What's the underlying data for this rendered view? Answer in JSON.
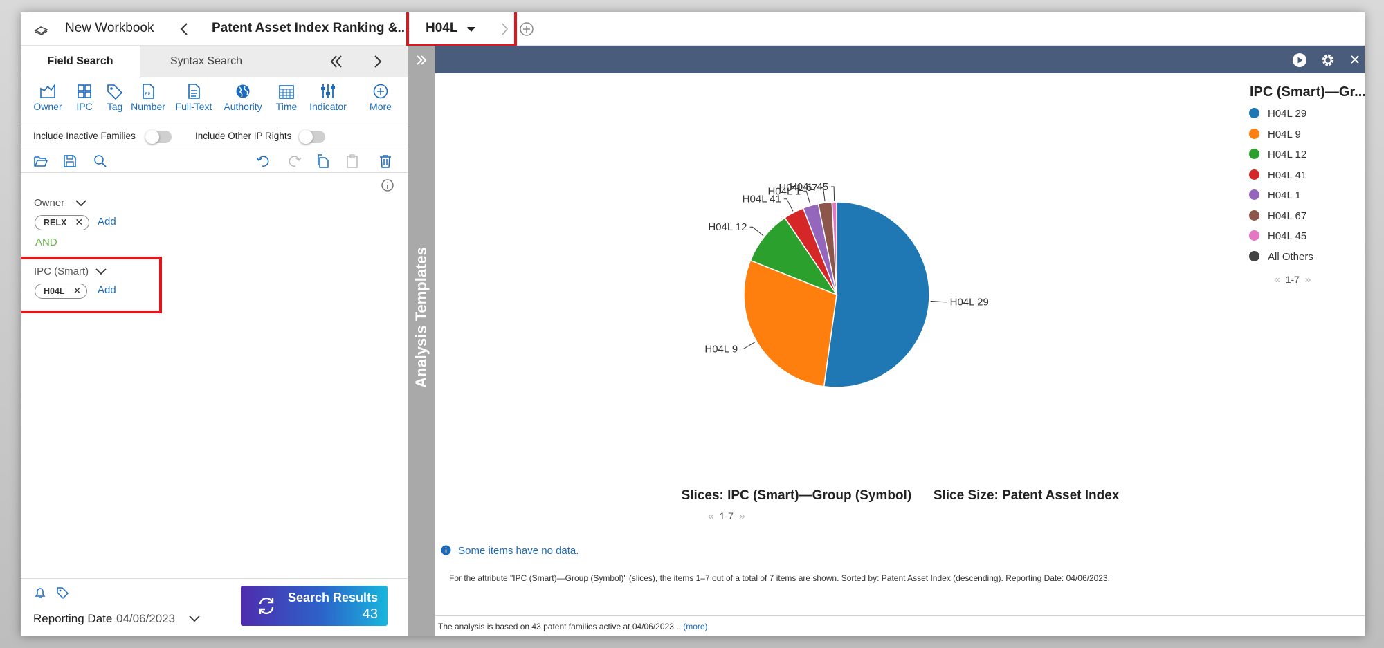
{
  "topbar": {
    "workbook_label": "New Workbook",
    "breadcrumb_title": "Patent Asset Index Ranking &...",
    "active_tab": "H04L"
  },
  "search_panel": {
    "tabs": [
      "Field Search",
      "Syntax Search"
    ],
    "tools": [
      {
        "label": "Owner",
        "icon": "owner-icon"
      },
      {
        "label": "IPC",
        "icon": "grid-icon"
      },
      {
        "label": "Tag",
        "icon": "tag-icon"
      },
      {
        "label": "Number",
        "icon": "document-icon"
      },
      {
        "label": "Full-Text",
        "icon": "document-icon"
      },
      {
        "label": "Authority",
        "icon": "globe-icon"
      },
      {
        "label": "Time",
        "icon": "calendar-icon"
      },
      {
        "label": "Indicator",
        "icon": "sliders-icon"
      },
      {
        "label": "More",
        "icon": "plus-circle-icon"
      }
    ],
    "include_inactive_label": "Include Inactive Families",
    "include_other_ip_label": "Include Other IP Rights",
    "query": {
      "owner_label": "Owner",
      "owner_chip": "RELX",
      "add_label": "Add",
      "operator": "AND",
      "ipc_label": "IPC (Smart)",
      "ipc_chip": "H04L"
    },
    "reporting_date_label": "Reporting Date",
    "reporting_date_value": "04/06/2023",
    "search_results_label": "Search Results",
    "search_results_count": "43"
  },
  "analysis_templates_label": "Analysis Templates",
  "chart_data": {
    "type": "pie",
    "title": "",
    "slices_caption": "Slices:  IPC (Smart)—Group (Symbol)",
    "size_caption": "Slice Size:  Patent Asset Index",
    "legend_title": "IPC (Smart)—Gr...",
    "categories": [
      "H04L 29",
      "H04L 9",
      "H04L 12",
      "H04L 41",
      "H04L 1",
      "H04L 67",
      "H04L 45"
    ],
    "values": [
      52.5,
      29.0,
      9.6,
      3.6,
      2.7,
      2.4,
      0.8
    ],
    "colors": [
      "#1f77b4",
      "#ff7f0e",
      "#2ca02c",
      "#d62728",
      "#9467bd",
      "#8c564b",
      "#e377c2"
    ],
    "legend_extra": {
      "label": "All Others",
      "color": "#444444"
    },
    "legend_placement": "right"
  },
  "chart_panel": {
    "pager_text": "1-7",
    "legend_pager_text": "1-7",
    "info_note": "Some items have no data.",
    "fine_print": "For the attribute \"IPC (Smart)—Group (Symbol)\" (slices), the items 1–7 out of a total of 7 items are shown. Sorted by: Patent Asset Index (descending). Reporting Date: 04/06/2023.",
    "status_text": "The analysis is based on 43 patent families active at 04/06/2023....",
    "more_link": "(more)"
  }
}
